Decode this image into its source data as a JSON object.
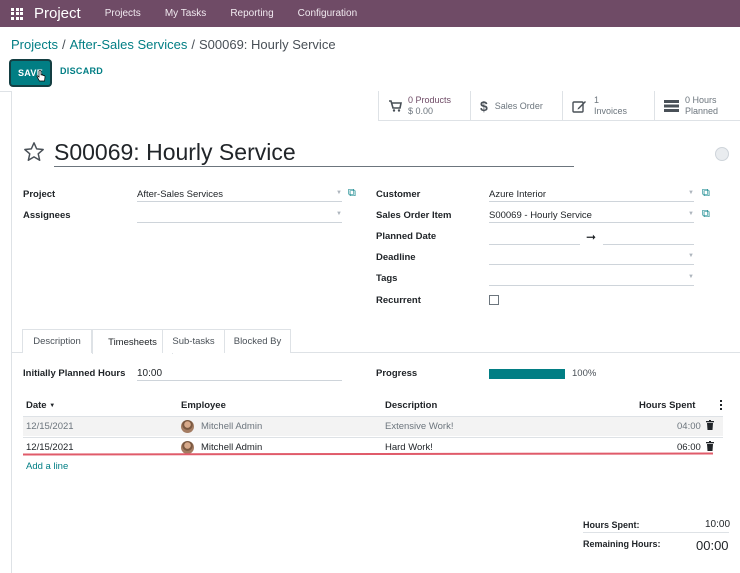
{
  "app": {
    "brand": "Project"
  },
  "nav": [
    "Projects",
    "My Tasks",
    "Reporting",
    "Configuration"
  ],
  "breadcrumb": {
    "projects": "Projects",
    "project": "After-Sales Services",
    "current": "S00069: Hourly Service",
    "separator": "/"
  },
  "actions": {
    "save": "SAVE",
    "discard": "DISCARD"
  },
  "smart_buttons": {
    "products": {
      "value": "0 Products",
      "sub": "$ 0.00"
    },
    "sales_order": {
      "label": "Sales Order"
    },
    "invoices": {
      "value": "1",
      "sub": "Invoices"
    },
    "hours": {
      "value": "0  Hours",
      "sub": "Planned"
    }
  },
  "task": {
    "title": "S00069: Hourly Service"
  },
  "fields": {
    "project_label": "Project",
    "project_value": "After-Sales Services",
    "assignees_label": "Assignees",
    "customer_label": "Customer",
    "customer_value": "Azure Interior",
    "sale_line_label": "Sales Order Item",
    "sale_line_value": "S00069 - Hourly Service",
    "planned_date_label": "Planned Date",
    "deadline_label": "Deadline",
    "tags_label": "Tags",
    "recurrent_label": "Recurrent",
    "recurrent_checked": false
  },
  "tabs": [
    "Description",
    "Timesheets",
    "Sub-tasks",
    "Blocked By"
  ],
  "active_tab": "Timesheets",
  "timesheets": {
    "planned_label": "Initially Planned Hours",
    "planned_value": "10:00",
    "progress_label": "Progress",
    "progress_text": "100%",
    "progress_fraction": 1.0,
    "columns": {
      "date": "Date",
      "employee": "Employee",
      "description": "Description",
      "hours": "Hours Spent"
    },
    "sort_indicator": "▼",
    "rows": [
      {
        "date": "12/15/2021",
        "employee": "Mitchell Admin",
        "description": "Extensive Work!",
        "hours": "04:00"
      },
      {
        "date": "12/15/2021",
        "employee": "Mitchell Admin",
        "description": "Hard Work!",
        "hours": "06:00"
      }
    ],
    "add_line": "Add a line"
  },
  "summary": {
    "spent_label": "Hours Spent:",
    "spent_value": "10:00",
    "remaining_label": "Remaining Hours:",
    "remaining_value": "00:00"
  },
  "colors": {
    "topbar": "#6f4b66",
    "accent": "#017e84",
    "red_underline": "#e05b6a"
  }
}
